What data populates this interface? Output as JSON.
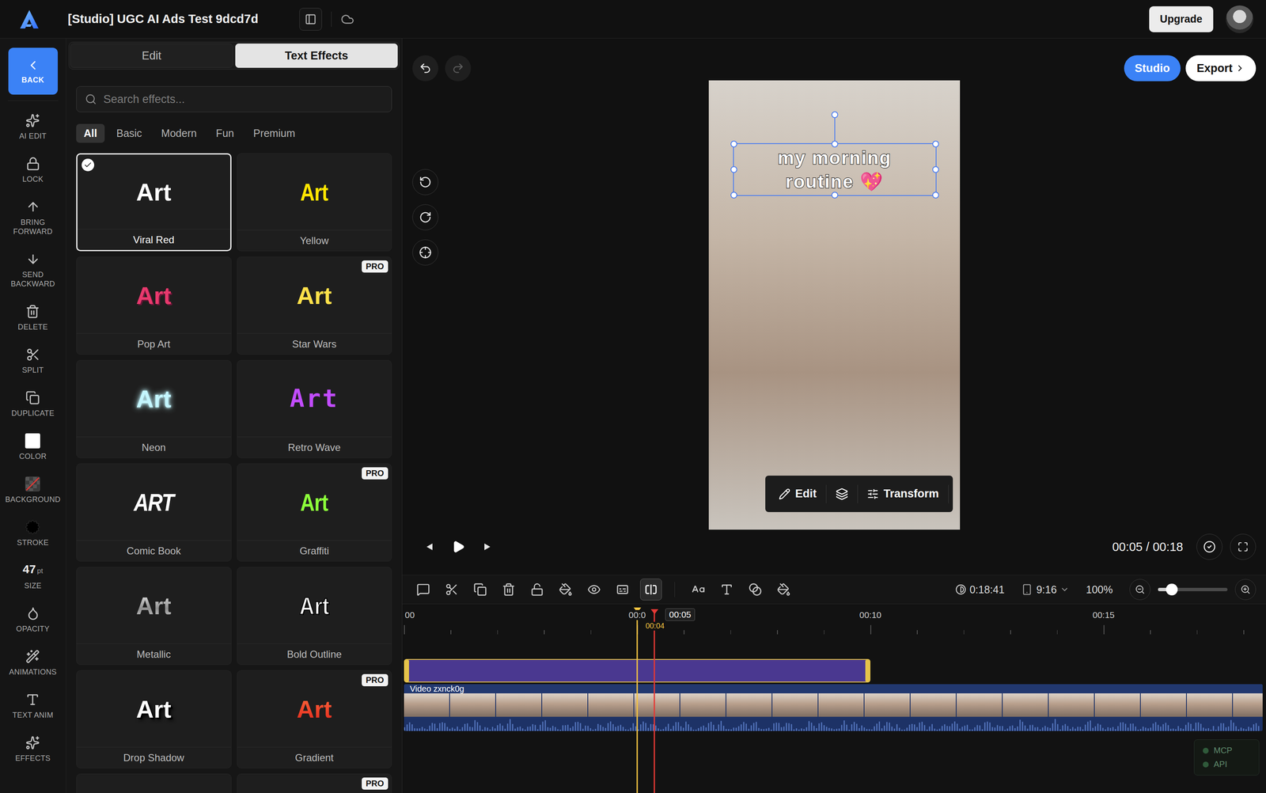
{
  "window": {
    "title": "[Studio] UGC AI Ads Test 9dcd7d"
  },
  "topbar": {
    "upgrade": "Upgrade"
  },
  "rail": [
    {
      "label": "BACK",
      "kind": "back"
    },
    {
      "label": "AI EDIT",
      "kind": "icon"
    },
    {
      "label": "LOCK",
      "kind": "icon"
    },
    {
      "label": "BRING FORWARD",
      "kind": "icon"
    },
    {
      "label": "SEND BACKWARD",
      "kind": "icon"
    },
    {
      "label": "DELETE",
      "kind": "icon"
    },
    {
      "label": "SPLIT",
      "kind": "icon"
    },
    {
      "label": "DUPLICATE",
      "kind": "icon"
    },
    {
      "label": "COLOR",
      "kind": "swatch",
      "color": "#ffffff"
    },
    {
      "label": "BACKGROUND",
      "kind": "none"
    },
    {
      "label": "STROKE",
      "kind": "stroke",
      "color": "#000000"
    },
    {
      "label": "SIZE",
      "kind": "value",
      "value": "47",
      "unit": "pt"
    },
    {
      "label": "OPACITY",
      "kind": "icon"
    },
    {
      "label": "ANIMATIONS",
      "kind": "icon"
    },
    {
      "label": "TEXT ANIM",
      "kind": "icon"
    },
    {
      "label": "EFFECTS",
      "kind": "icon"
    }
  ],
  "panel": {
    "tabs": [
      {
        "label": "Edit",
        "selected": false
      },
      {
        "label": "Text Effects",
        "selected": true
      }
    ],
    "search": {
      "placeholder": "Search effects..."
    },
    "filters": [
      {
        "label": "All",
        "selected": true
      },
      {
        "label": "Basic",
        "selected": false
      },
      {
        "label": "Modern",
        "selected": false
      },
      {
        "label": "Fun",
        "selected": false
      },
      {
        "label": "Premium",
        "selected": false
      }
    ],
    "pro_label": "PRO",
    "effects": [
      {
        "label": "Viral Red",
        "sample": "Art",
        "kind": "plain",
        "color": "#ffffff",
        "pro": false,
        "selected": true
      },
      {
        "label": "Yellow",
        "sample": "Art",
        "kind": "condensed",
        "color": "#ffe600",
        "pro": false,
        "selected": false
      },
      {
        "label": "Pop Art",
        "sample": "Art",
        "kind": "pop",
        "color": "#e8396d",
        "pro": false,
        "selected": false
      },
      {
        "label": "Star Wars",
        "sample": "Art",
        "kind": "plain",
        "color": "#ffe14a",
        "pro": true,
        "selected": false
      },
      {
        "label": "Neon",
        "sample": "Art",
        "kind": "neon",
        "color": "#c4f6ff",
        "pro": false,
        "selected": false
      },
      {
        "label": "Retro Wave",
        "sample": "Art",
        "kind": "retro",
        "color": "#c24cff",
        "pro": false,
        "selected": false
      },
      {
        "label": "Comic Book",
        "sample": "ART",
        "kind": "comic",
        "color": "#ffffff",
        "pro": false,
        "selected": false
      },
      {
        "label": "Graffiti",
        "sample": "Art",
        "kind": "condensed",
        "color": "#8cff3a",
        "pro": true,
        "selected": false
      },
      {
        "label": "Metallic",
        "sample": "Art",
        "kind": "metallic",
        "color": "#8f8f8f",
        "pro": false,
        "selected": false
      },
      {
        "label": "Bold Outline",
        "sample": "Art",
        "kind": "outline",
        "color": "#ffffff",
        "pro": false,
        "selected": false
      },
      {
        "label": "Drop Shadow",
        "sample": "Art",
        "kind": "shadow",
        "color": "#ffffff",
        "pro": false,
        "selected": false
      },
      {
        "label": "Gradient",
        "sample": "Art",
        "kind": "gradient",
        "color": "#e0261c",
        "pro": true,
        "selected": false
      }
    ],
    "more": [
      {
        "pro": false
      },
      {
        "pro": true
      }
    ]
  },
  "actions": {
    "studio": {
      "label": "Studio",
      "selected": true
    },
    "export": "Export"
  },
  "preview": {
    "text": "my morning routine 💖",
    "toolbar": {
      "edit": "Edit",
      "transform": "Transform"
    }
  },
  "playback": {
    "time": "00:05 / 00:18"
  },
  "timeline_toolbar": {
    "tools": [
      {
        "selected": false
      },
      {
        "selected": false
      },
      {
        "selected": false
      },
      {
        "selected": false
      },
      {
        "selected": false
      },
      {
        "selected": false
      },
      {
        "selected": false
      },
      {
        "selected": false
      },
      {
        "selected": true
      },
      {
        "selected": false
      },
      {
        "selected": false
      },
      {
        "selected": false
      },
      {
        "selected": false
      }
    ],
    "duration": "0:18:41",
    "aspect": "9:16",
    "zoom": "100%",
    "zoom_level": 0.2
  },
  "timeline": {
    "ruler": [
      {
        "label": "00",
        "seconds": 0
      },
      {
        "label": "00:0",
        "seconds": 5
      },
      {
        "label": "00:10",
        "seconds": 10
      },
      {
        "label": "00:15",
        "seconds": 15
      }
    ],
    "marker": {
      "label": "00:04",
      "seconds": 5,
      "color": "#f5c542"
    },
    "playhead": {
      "label": "00:05",
      "seconds": 5.37,
      "color": "#e53935"
    },
    "text_clip": {
      "start": 0,
      "end": 10,
      "selected": true
    },
    "video": {
      "label": "Video zxnck0g",
      "start": 0,
      "end": 18.41
    }
  },
  "status": [
    {
      "label": "MCP",
      "on": false
    },
    {
      "label": "API",
      "on": false
    }
  ]
}
